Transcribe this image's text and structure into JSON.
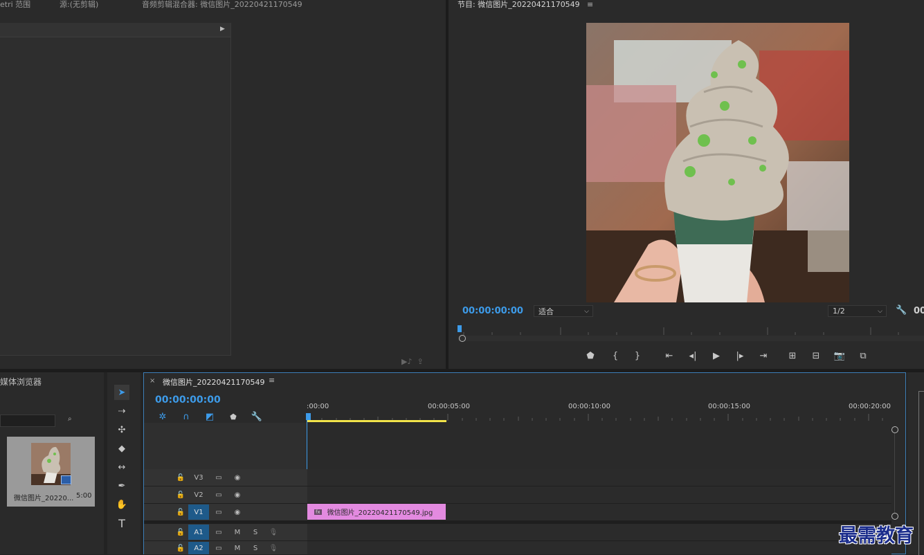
{
  "top_tabs": {
    "lumetri": "etri 范围",
    "source": "源:(无剪辑)",
    "audio_mixer": "音频剪辑混合器: 微信图片_20220421170549",
    "program": "节目: 微信图片_20220421170549"
  },
  "program": {
    "timecode": "00:00:00:00",
    "fit_select": "适合",
    "resolution_select": "1/2",
    "right_timecode": "00"
  },
  "media_browser": {
    "title": "媒体浏览器"
  },
  "project_item": {
    "name": "微信图片_20220...",
    "duration": "5:00"
  },
  "timeline": {
    "close": "×",
    "title": "微信图片_20220421170549",
    "timecode": "00:00:00:00",
    "ruler": [
      ":00:00",
      "00:00:05:00",
      "00:00:10:00",
      "00:00:15:00",
      "00:00:20:00"
    ],
    "tracks": [
      {
        "name": "V3",
        "type": "video"
      },
      {
        "name": "V2",
        "type": "video"
      },
      {
        "name": "V1",
        "type": "video"
      },
      {
        "name": "A1",
        "type": "audio"
      },
      {
        "name": "A2",
        "type": "audio"
      }
    ],
    "clip_label": "微信图片_20220421170549.jpg",
    "mute_label": "M",
    "solo_label": "S",
    "fx": "fx"
  },
  "colors": {
    "accent_blue": "#3d9be9",
    "clip_pink": "#e38ae0",
    "work_area_yellow": "#f2e44a",
    "track_target_blue": "#1e5a8a"
  },
  "watermark": "最需教育"
}
